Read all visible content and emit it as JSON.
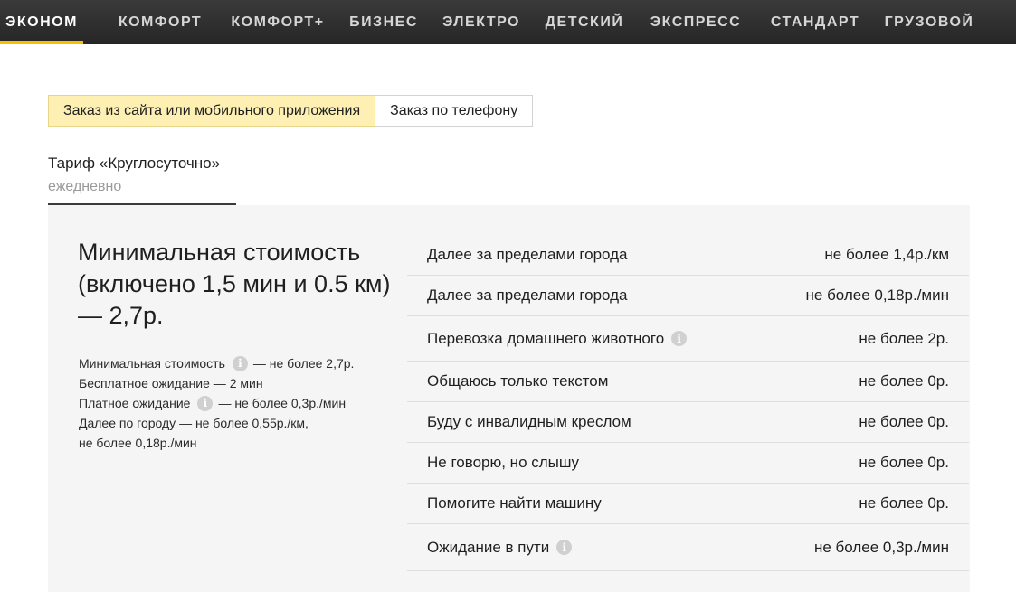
{
  "tabs": [
    {
      "label": "Эконом",
      "active": true
    },
    {
      "label": "Комфорт"
    },
    {
      "label": "Комфорт+"
    },
    {
      "label": "Бизнес"
    },
    {
      "label": "Электро"
    },
    {
      "label": "Детский"
    },
    {
      "label": "Экспресс"
    },
    {
      "label": "Стандарт"
    },
    {
      "label": "Грузовой"
    }
  ],
  "order_type": {
    "app": "Заказ из сайта или мобильного приложения",
    "phone": "Заказ по телефону"
  },
  "tariff": {
    "title": "Тариф «Круглосуточно»",
    "schedule": "ежедневно"
  },
  "min_cost": {
    "headline": "Минимальная стоимость (включено 1,5 мин и 0.5 км) — 2,7р.",
    "details": {
      "min_label": "Минимальная стоимость",
      "min_value": "— не более 2,7р.",
      "free_wait": "Бесплатное ожидание — 2 мин",
      "paid_wait_label": "Платное ожидание",
      "paid_wait_value": "— не более 0,3р./мин",
      "city_line1": "Далее по городу — не более 0,55р./км,",
      "city_line2": "не более 0,18р./мин"
    }
  },
  "rates": [
    {
      "name": "Далее за пределами города",
      "value": "не более 1,4р./км",
      "info": false
    },
    {
      "name": "Далее за пределами города",
      "value": "не более 0,18р./мин",
      "info": false
    },
    {
      "name": "Перевозка домашнего животного",
      "value": "не более 2р.",
      "info": true
    },
    {
      "name": "Общаюсь только текстом",
      "value": "не более 0р.",
      "info": false
    },
    {
      "name": "Буду с инвалидным креслом",
      "value": "не более 0р.",
      "info": false
    },
    {
      "name": "Не говорю, но слышу",
      "value": "не более 0р.",
      "info": false
    },
    {
      "name": "Помогите найти машину",
      "value": "не более 0р.",
      "info": false
    },
    {
      "name": "Ожидание в пути",
      "value": "не более 0,3р./мин",
      "info": true
    }
  ],
  "colors": {
    "accent": "#f5c000",
    "toggle_active": "#fdf0b2",
    "panel": "#f5f5f5",
    "header": "#2b2b2b"
  },
  "icons": {
    "info": "info-icon"
  }
}
